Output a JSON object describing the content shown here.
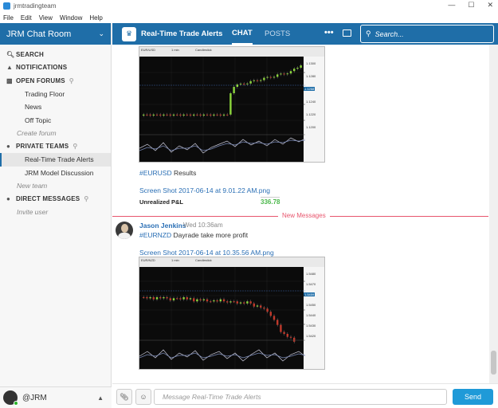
{
  "window": {
    "title": "jrmtradingteam",
    "minimize": "—",
    "maximize": "☐",
    "close": "✕"
  },
  "menu": [
    "File",
    "Edit",
    "View",
    "Window",
    "Help"
  ],
  "sidebar": {
    "team_name": "JRM Chat Room",
    "search": "SEARCH",
    "notifications": "NOTIFICATIONS",
    "open_forums": "OPEN FORUMS",
    "forums": [
      "Trading Floor",
      "News",
      "Off Topic"
    ],
    "create_forum": "Create forum",
    "private_teams": "PRIVATE TEAMS",
    "teams": [
      "Real-Time Trade Alerts",
      "JRM Model Discussion"
    ],
    "new_team": "New team",
    "direct_messages": "DIRECT MESSAGES",
    "invite_user": "Invite user",
    "user": "@JRM"
  },
  "header": {
    "channel": "Real-Time Trade Alerts",
    "tab_chat": "CHAT",
    "tab_posts": "POSTS",
    "search_placeholder": "Search..."
  },
  "messages": {
    "first": {
      "hashtag": "#EURUSD",
      "text": "Results",
      "attachment": "Screen Shot 2017-06-14 at 9.01.22 AM.png",
      "pnl_label": "Unrealized P&L",
      "pnl_value": "336.78",
      "chart_symbol": "EUR/USD",
      "chart_tf": "1 min",
      "chart_style": "Candlestick",
      "price_ticks": [
        "1.1300",
        "1.1280",
        "1.1260",
        "1.1240",
        "1.1220",
        "1.1200"
      ],
      "price_marker": "1.1268"
    },
    "divider": "New Messages",
    "second": {
      "author": "Jason Jenkins",
      "time": "Wed 10:36am",
      "hashtag": "#EURNZD",
      "text": "Dayrade take more profit",
      "attachment": "Screen Shot 2017-06-14 at 10.35.56 AM.png",
      "chart_symbol": "EUR/NZD",
      "chart_tf": "1 min",
      "chart_style": "Candlestick",
      "price_ticks": [
        "1.5480",
        "1.5470",
        "1.5460",
        "1.5450",
        "1.5440",
        "1.5430",
        "1.5420"
      ],
      "price_marker": "1.5459"
    }
  },
  "composer": {
    "placeholder": "Message Real-Time Trade Alerts",
    "send": "Send"
  },
  "colors": {
    "brand": "#1f6ea8",
    "new_messages": "#e8556d",
    "pnl": "#4bb84b",
    "send": "#1f9ad8"
  }
}
